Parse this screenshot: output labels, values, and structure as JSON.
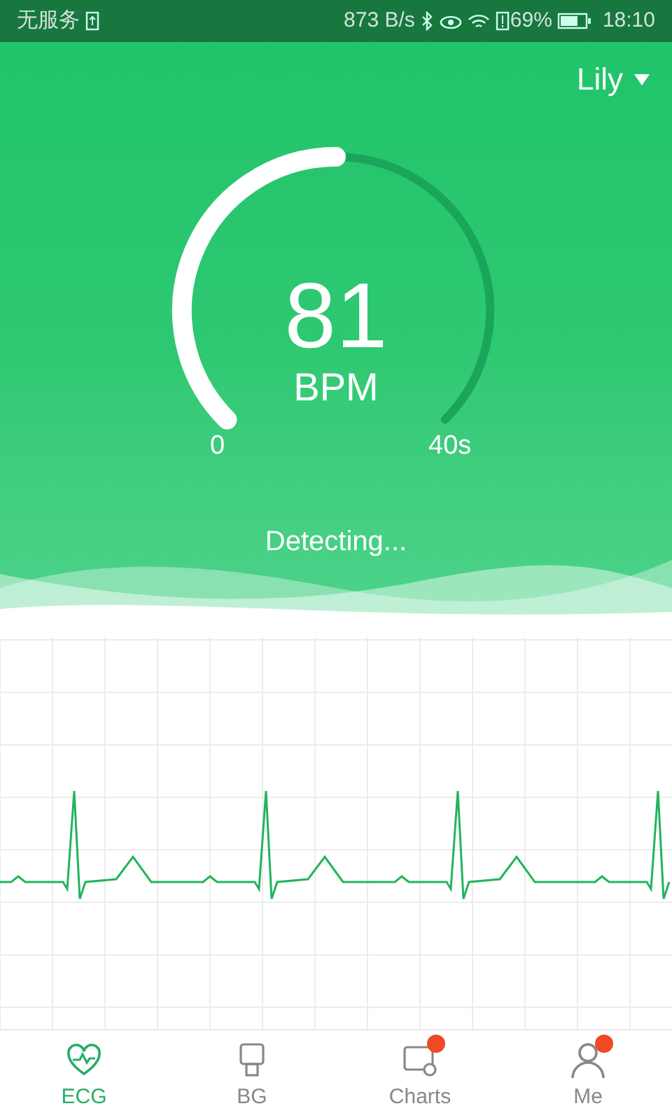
{
  "status_bar": {
    "carrier": "无服务",
    "speed": "873 B/s",
    "battery": "69%",
    "time": "18:10"
  },
  "user": {
    "name": "Lily"
  },
  "gauge": {
    "value": "81",
    "unit": "BPM",
    "start_label": "0",
    "end_label": "40s"
  },
  "status_text": "Detecting...",
  "tabs": [
    {
      "kind": "ecg",
      "label": "ECG",
      "selected": true,
      "badge": false
    },
    {
      "kind": "bg",
      "label": "BG",
      "selected": false,
      "badge": false
    },
    {
      "kind": "charts",
      "label": "Charts",
      "selected": false,
      "badge": true
    },
    {
      "kind": "me",
      "label": "Me",
      "selected": false,
      "badge": true
    }
  ]
}
